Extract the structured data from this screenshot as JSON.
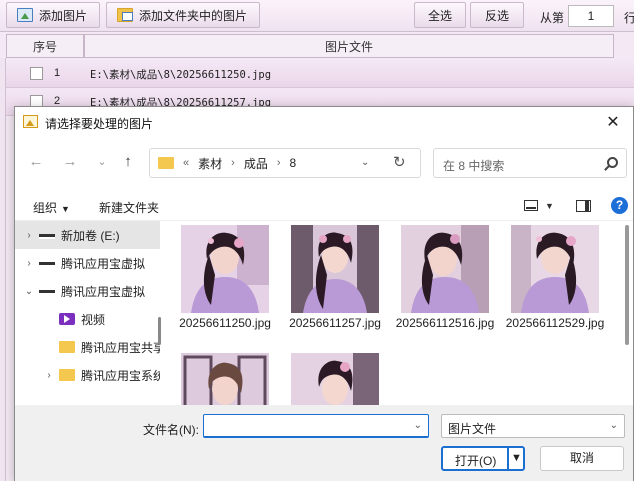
{
  "app": {
    "toolbar": {
      "add_image": "添加图片",
      "add_folder_images": "添加文件夹中的图片",
      "select_all": "全选",
      "invert_select": "反选",
      "from_label": "从第",
      "from_value": "1",
      "row_label": "行"
    },
    "table": {
      "headers": [
        "序号",
        "图片文件"
      ],
      "rows": [
        {
          "index": "1",
          "path": "E:\\素材\\成品\\8\\20256611250.jpg"
        },
        {
          "index": "2",
          "path": "E:\\素材\\成品\\8\\20256611257.jpg"
        }
      ]
    }
  },
  "dialog": {
    "title": "请选择要处理的图片",
    "close": "✕",
    "nav": {
      "back": "←",
      "forward": "→",
      "recent": "⌄",
      "up": "↑"
    },
    "breadcrumb": [
      "«",
      "素材",
      "›",
      "成品",
      "›",
      "8"
    ],
    "search_placeholder": "在 8 中搜索",
    "commands": {
      "organize": "组织",
      "new_folder": "新建文件夹"
    },
    "tree": [
      {
        "label": "新加卷 (E:)",
        "chev": "›",
        "icon": "drive-icon",
        "selected": true
      },
      {
        "label": "腾讯应用宝虚拟",
        "chev": "›",
        "icon": "drive-icon",
        "selected": false
      },
      {
        "label": "腾讯应用宝虚拟",
        "chev": "⌄",
        "icon": "drive-icon",
        "selected": false
      },
      {
        "label": "视频",
        "chev": "",
        "icon": "video-icon",
        "selected": false
      },
      {
        "label": "腾讯应用宝共享",
        "chev": "",
        "icon": "folder-icon",
        "selected": false
      },
      {
        "label": "腾讯应用宝系统",
        "chev": "›",
        "icon": "folder-icon",
        "selected": false
      }
    ],
    "files": [
      {
        "name": "20256611250.jpg"
      },
      {
        "name": "20256611257.jpg"
      },
      {
        "name": "202566112516.jpg"
      },
      {
        "name": "202566112529.jpg"
      },
      {
        "name": ""
      },
      {
        "name": ""
      }
    ],
    "filename_label": "文件名(N):",
    "filename_value": "",
    "filetype": "图片文件",
    "open_label": "打开(O)",
    "cancel_label": "取消"
  },
  "colors": {
    "accent": "#1a6fd1",
    "toolbar_bg": "#efe2ef",
    "row_bg": "#ead7ea",
    "dress": "#b99ad6"
  }
}
